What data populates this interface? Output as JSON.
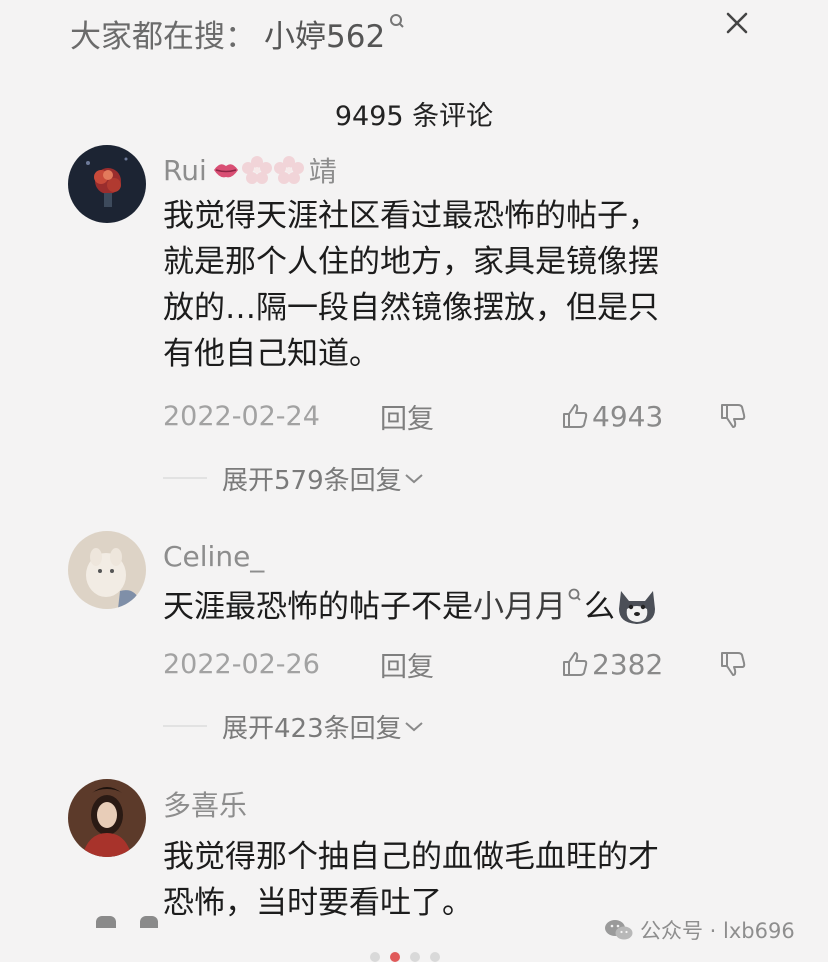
{
  "search": {
    "prefix": "大家都在搜：",
    "term": "小婷562",
    "search_icon": "search-icon",
    "close_icon": "close-icon"
  },
  "comment_count": "9495 条评论",
  "comments": [
    {
      "author": "Rui",
      "author_suffix": "靖",
      "author_decorations": [
        "lips-emoji",
        "sakura-emoji",
        "sakura-emoji"
      ],
      "body_lines": [
        "我觉得天涯社区看过最恐怖的帖子，",
        "就是那个人住的地方，家具是镜像摆",
        "放的…隔一段自然镜像摆放，但是只",
        "有他自己知道。"
      ],
      "date": "2022-02-24",
      "reply_label": "回复",
      "likes": "4943",
      "expand_label": "展开579条回复"
    },
    {
      "author": "Celine_",
      "body_before": "天涯最恐怖的帖子不是",
      "body_link": "小月月",
      "body_after": "么",
      "body_emoji": "husky-emoji",
      "date": "2022-02-26",
      "reply_label": "回复",
      "likes": "2382",
      "expand_label": "展开423条回复"
    },
    {
      "author": "多喜乐",
      "body_lines": [
        "我觉得那个抽自己的血做毛血旺的才",
        "恐怖，当时要看吐了。"
      ]
    }
  ],
  "watermark": {
    "text": "公众号 · lxb696",
    "icon": "wechat-icon"
  },
  "colors": {
    "background": "#f4f3f3",
    "text": "#1c1c1c",
    "muted": "#8d8d8d",
    "page_indicator_active": "#e05a5a"
  }
}
